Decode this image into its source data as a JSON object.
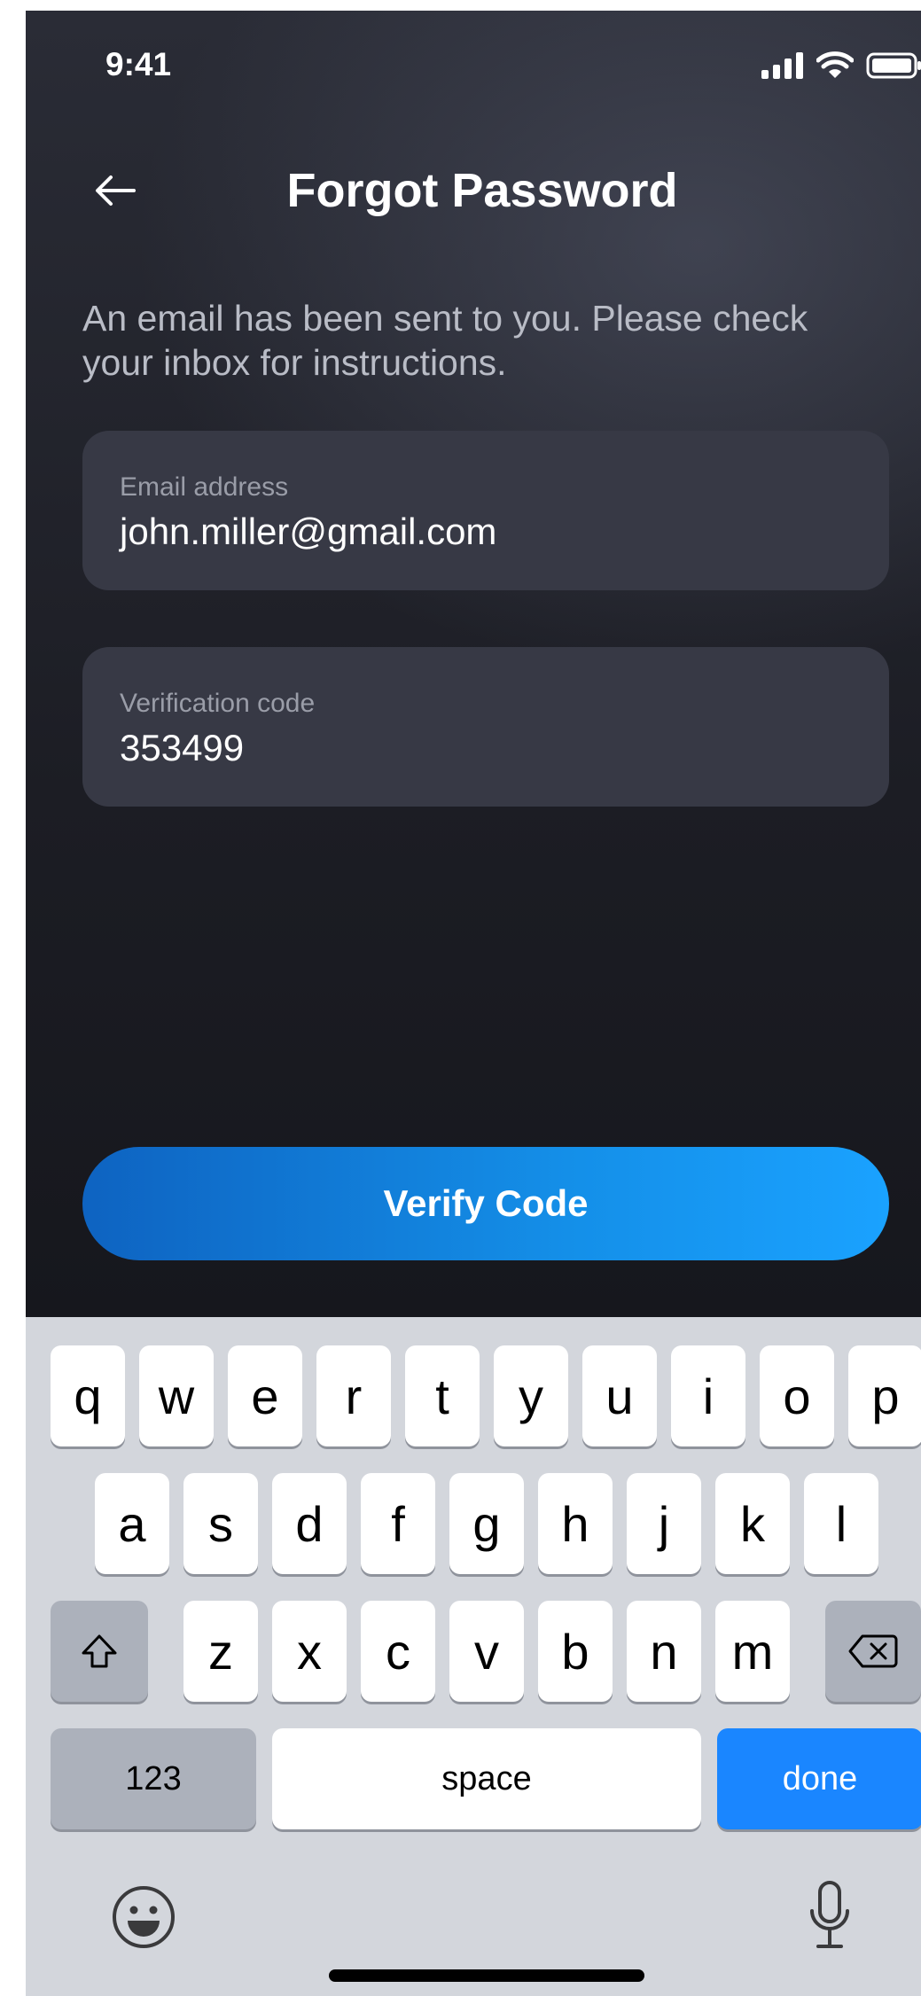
{
  "status_bar": {
    "time": "9:41"
  },
  "header": {
    "title": "Forgot Password"
  },
  "message": "An email has been sent to you. Please check your inbox for instructions.",
  "email_field": {
    "label": "Email address",
    "value": "john.miller@gmail.com"
  },
  "code_field": {
    "label": "Verification code",
    "value": "353499"
  },
  "verify_button": {
    "label": "Verify Code"
  },
  "keyboard": {
    "row1": [
      "q",
      "w",
      "e",
      "r",
      "t",
      "y",
      "u",
      "i",
      "o",
      "p"
    ],
    "row2": [
      "a",
      "s",
      "d",
      "f",
      "g",
      "h",
      "j",
      "k",
      "l"
    ],
    "row3": [
      "z",
      "x",
      "c",
      "v",
      "b",
      "n",
      "m"
    ],
    "numbers_key": "123",
    "space_key": "space",
    "done_key": "done",
    "icons": [
      "shift-icon",
      "backspace-icon",
      "emoji-icon",
      "microphone-icon"
    ]
  },
  "colors": {
    "accent": "#1a86ff",
    "background": "#1c1d24",
    "field": "#373945"
  }
}
